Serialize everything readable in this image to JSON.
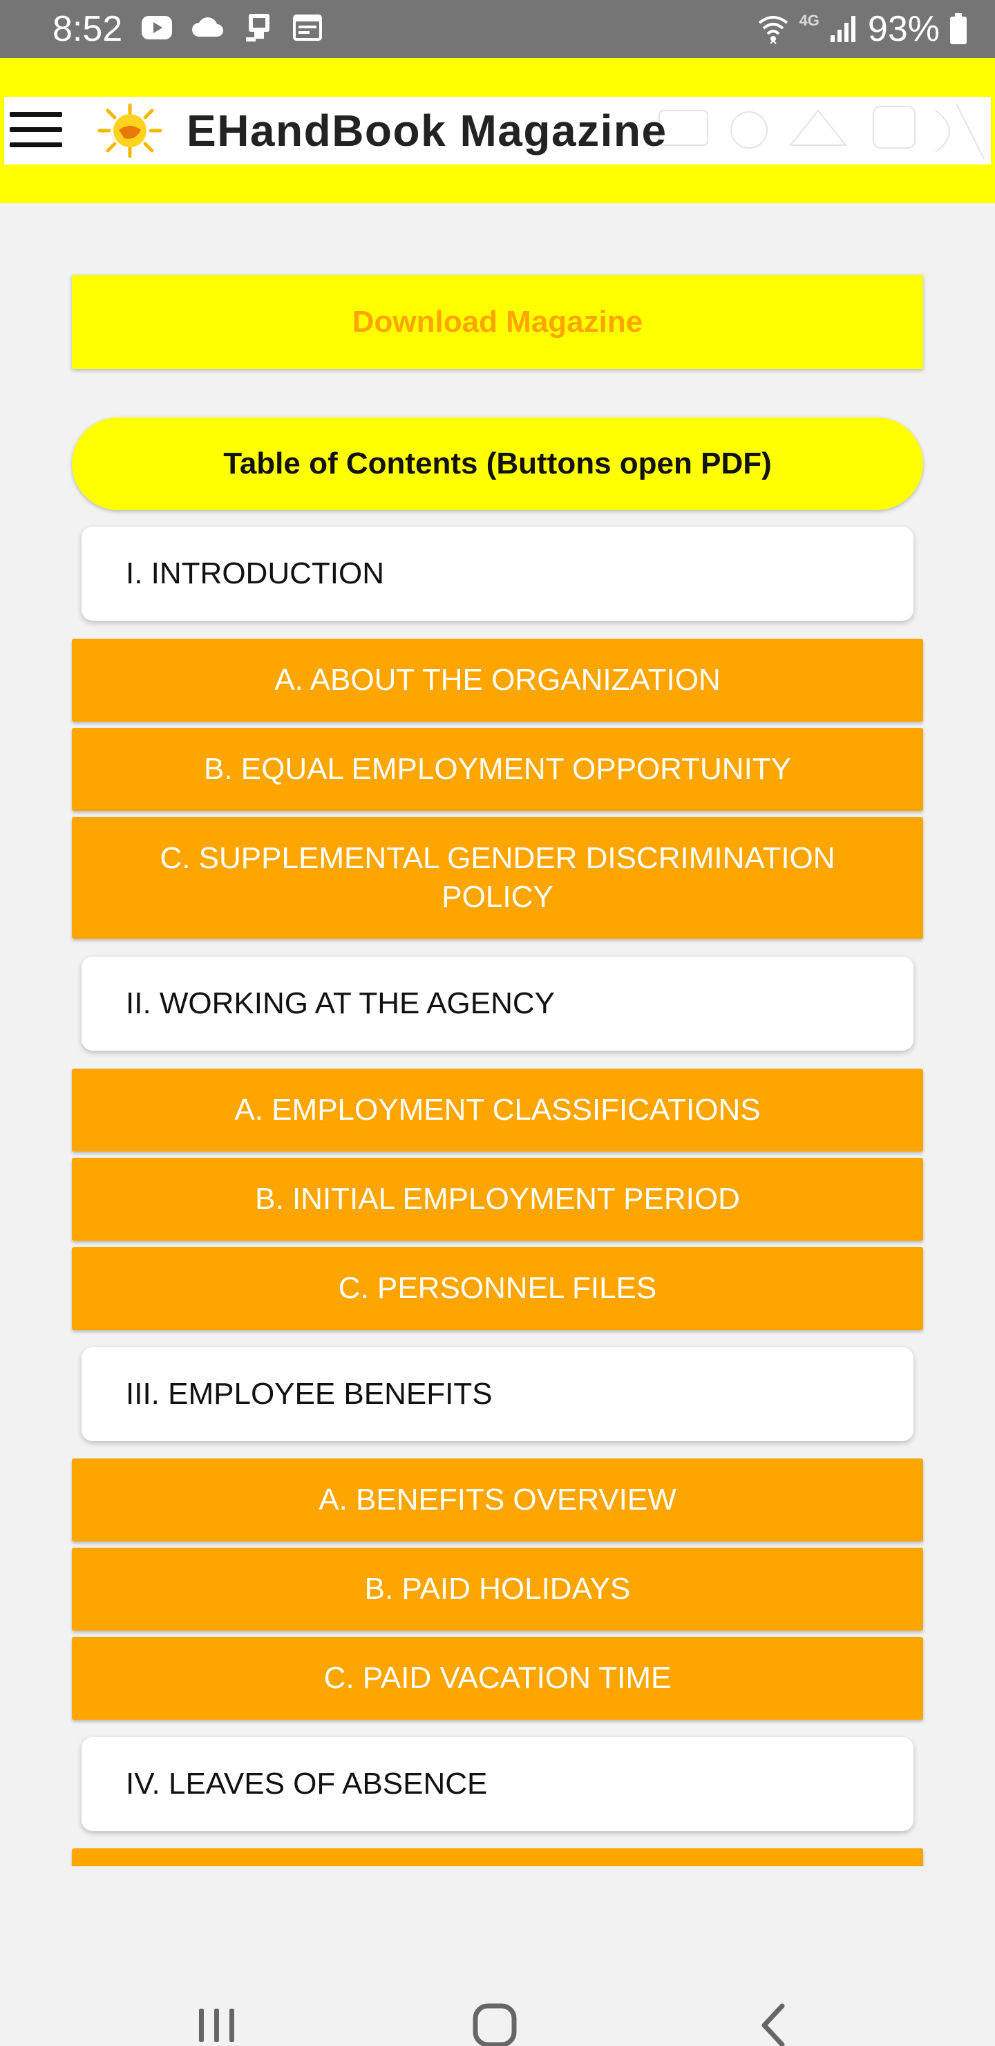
{
  "status_bar": {
    "time": "8:52",
    "network": "4G",
    "battery": "93%",
    "left_icons": [
      "youtube-icon",
      "cloud-icon",
      "cast-icon",
      "calendar-icon"
    ],
    "right_icons": [
      "wifi-icon",
      "signal-icon",
      "battery-icon"
    ]
  },
  "header": {
    "title": "EHandBook Magazine",
    "menu_icon": "hamburger-menu-icon",
    "logo_icon": "sun-logo-icon"
  },
  "download": {
    "label": "Download Magazine"
  },
  "toc": {
    "title": "Table of Contents (Buttons open PDF)",
    "sections": [
      {
        "title": "I. INTRODUCTION",
        "items": [
          "A. ABOUT THE ORGANIZATION",
          "B. EQUAL EMPLOYMENT OPPORTUNITY",
          "C. SUPPLEMENTAL GENDER DISCRIMINATION POLICY"
        ]
      },
      {
        "title": "II. WORKING AT THE AGENCY",
        "items": [
          "A. EMPLOYMENT CLASSIFICATIONS",
          "B. INITIAL EMPLOYMENT PERIOD",
          "C. PERSONNEL FILES"
        ]
      },
      {
        "title": "III. EMPLOYEE BENEFITS",
        "items": [
          "A. BENEFITS OVERVIEW",
          "B. PAID HOLIDAYS",
          "C. PAID VACATION TIME"
        ]
      },
      {
        "title": "IV. LEAVES OF ABSENCE",
        "items": []
      }
    ]
  },
  "colors": {
    "yellow": "#ffff00",
    "orange": "#ffa500",
    "status_bar": "#757575",
    "background": "#f2f2f2"
  },
  "nav_bar": {
    "icons": [
      "recent-apps-icon",
      "home-icon",
      "back-icon"
    ]
  }
}
